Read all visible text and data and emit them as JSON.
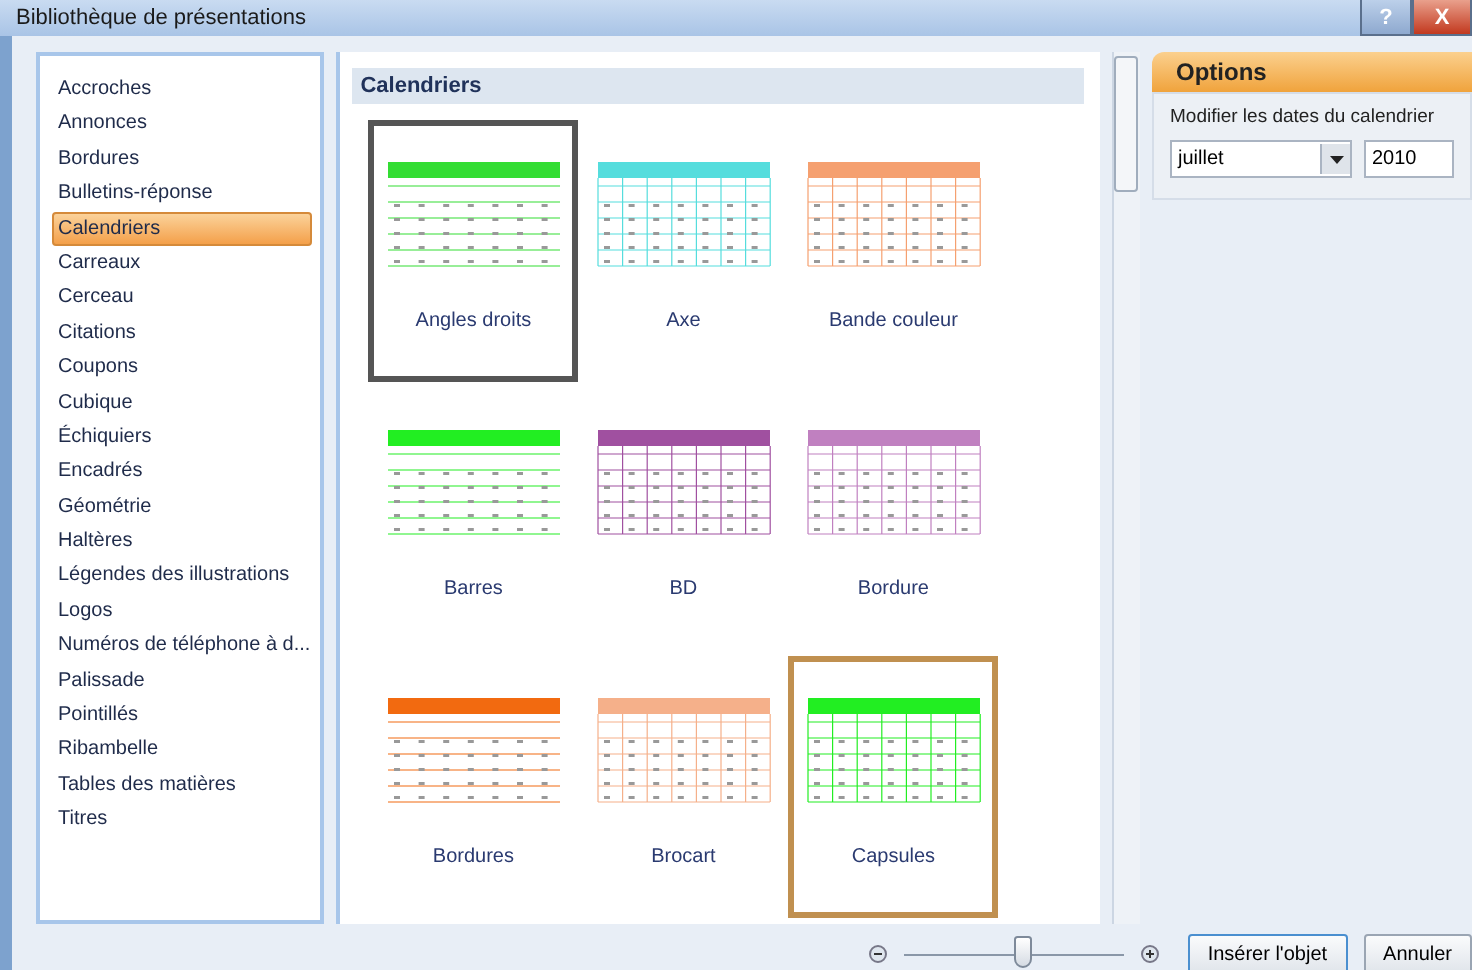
{
  "window": {
    "title": "Bibliothèque de présentations",
    "buttons": [
      {
        "kind": "help",
        "label": "?"
      },
      {
        "kind": "close",
        "label": "X"
      }
    ]
  },
  "categories": [
    {
      "label": "Accroches",
      "selected": false
    },
    {
      "label": "Annonces",
      "selected": false
    },
    {
      "label": "Bordures",
      "selected": false
    },
    {
      "label": "Bulletins-réponse",
      "selected": false
    },
    {
      "label": "Calendriers",
      "selected": true
    },
    {
      "label": "Carreaux",
      "selected": false
    },
    {
      "label": "Cerceau",
      "selected": false
    },
    {
      "label": "Citations",
      "selected": false
    },
    {
      "label": "Coupons",
      "selected": false
    },
    {
      "label": "Cubique",
      "selected": false
    },
    {
      "label": "Échiquiers",
      "selected": false
    },
    {
      "label": "Encadrés",
      "selected": false
    },
    {
      "label": "Géométrie",
      "selected": false
    },
    {
      "label": "Haltères",
      "selected": false
    },
    {
      "label": "Légendes des illustrations",
      "selected": false
    },
    {
      "label": "Logos",
      "selected": false
    },
    {
      "label": "Numéros de téléphone à d...",
      "selected": false
    },
    {
      "label": "Palissade",
      "selected": false
    },
    {
      "label": "Pointillés",
      "selected": false
    },
    {
      "label": "Ribambelle",
      "selected": false
    },
    {
      "label": "Tables des matières",
      "selected": false
    },
    {
      "label": "Titres",
      "selected": false
    }
  ],
  "gallery": {
    "heading": "Calendriers",
    "items": [
      {
        "label": "Angles droits",
        "selected": true,
        "hovered": false,
        "color": "#33dd33"
      },
      {
        "label": "Axe",
        "selected": false,
        "hovered": false,
        "color": "#55dddd"
      },
      {
        "label": "Bande couleur",
        "selected": false,
        "hovered": false,
        "color": "#f5a070"
      },
      {
        "label": "Barres",
        "selected": false,
        "hovered": false,
        "color": "#22ee22"
      },
      {
        "label": "BD",
        "selected": false,
        "hovered": false,
        "color": "#a050a0"
      },
      {
        "label": "Bordure",
        "selected": false,
        "hovered": false,
        "color": "#c080c0"
      },
      {
        "label": "Bordures",
        "selected": false,
        "hovered": false,
        "color": "#f26a10"
      },
      {
        "label": "Brocart",
        "selected": false,
        "hovered": false,
        "color": "#f5b08a"
      },
      {
        "label": "Capsules",
        "selected": false,
        "hovered": true,
        "color": "#22ee22"
      }
    ]
  },
  "options": {
    "title": "Options",
    "label": "Modifier les dates du calendrier",
    "month": "juillet",
    "year": "2010"
  },
  "zoom": {
    "level": 0.55
  },
  "buttons": [
    {
      "label": "Insérer l'objet",
      "selected": true
    },
    {
      "label": "Annuler",
      "selected": false
    }
  ]
}
